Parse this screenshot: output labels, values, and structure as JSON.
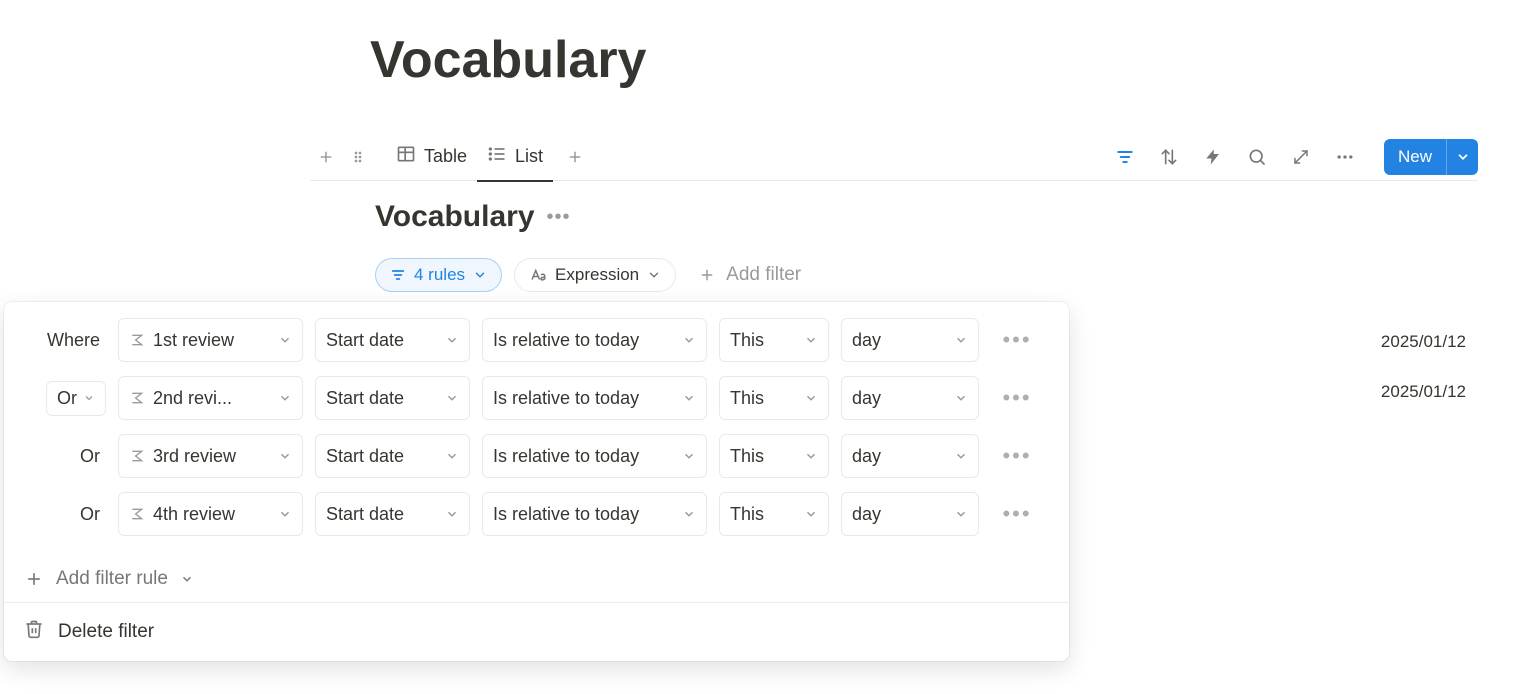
{
  "page": {
    "title": "Vocabulary"
  },
  "views": {
    "table": "Table",
    "list": "List"
  },
  "toolbar": {
    "new_label": "New"
  },
  "db": {
    "title": "Vocabulary"
  },
  "chips": {
    "rules_label": "4 rules",
    "expression_label": "Expression",
    "add_filter_label": "Add filter"
  },
  "filter": {
    "where_label": "Where",
    "or_label": "Or",
    "rows": [
      {
        "field": "1st review",
        "prop": "Start date",
        "op": "Is relative to today",
        "rel": "This",
        "unit": "day"
      },
      {
        "field": "2nd revi...",
        "prop": "Start date",
        "op": "Is relative to today",
        "rel": "This",
        "unit": "day"
      },
      {
        "field": "3rd review",
        "prop": "Start date",
        "op": "Is relative to today",
        "rel": "This",
        "unit": "day"
      },
      {
        "field": "4th review",
        "prop": "Start date",
        "op": "Is relative to today",
        "rel": "This",
        "unit": "day"
      }
    ],
    "add_rule_label": "Add filter rule",
    "delete_label": "Delete filter"
  },
  "list_dates": [
    "2025/01/12",
    "2025/01/12"
  ]
}
